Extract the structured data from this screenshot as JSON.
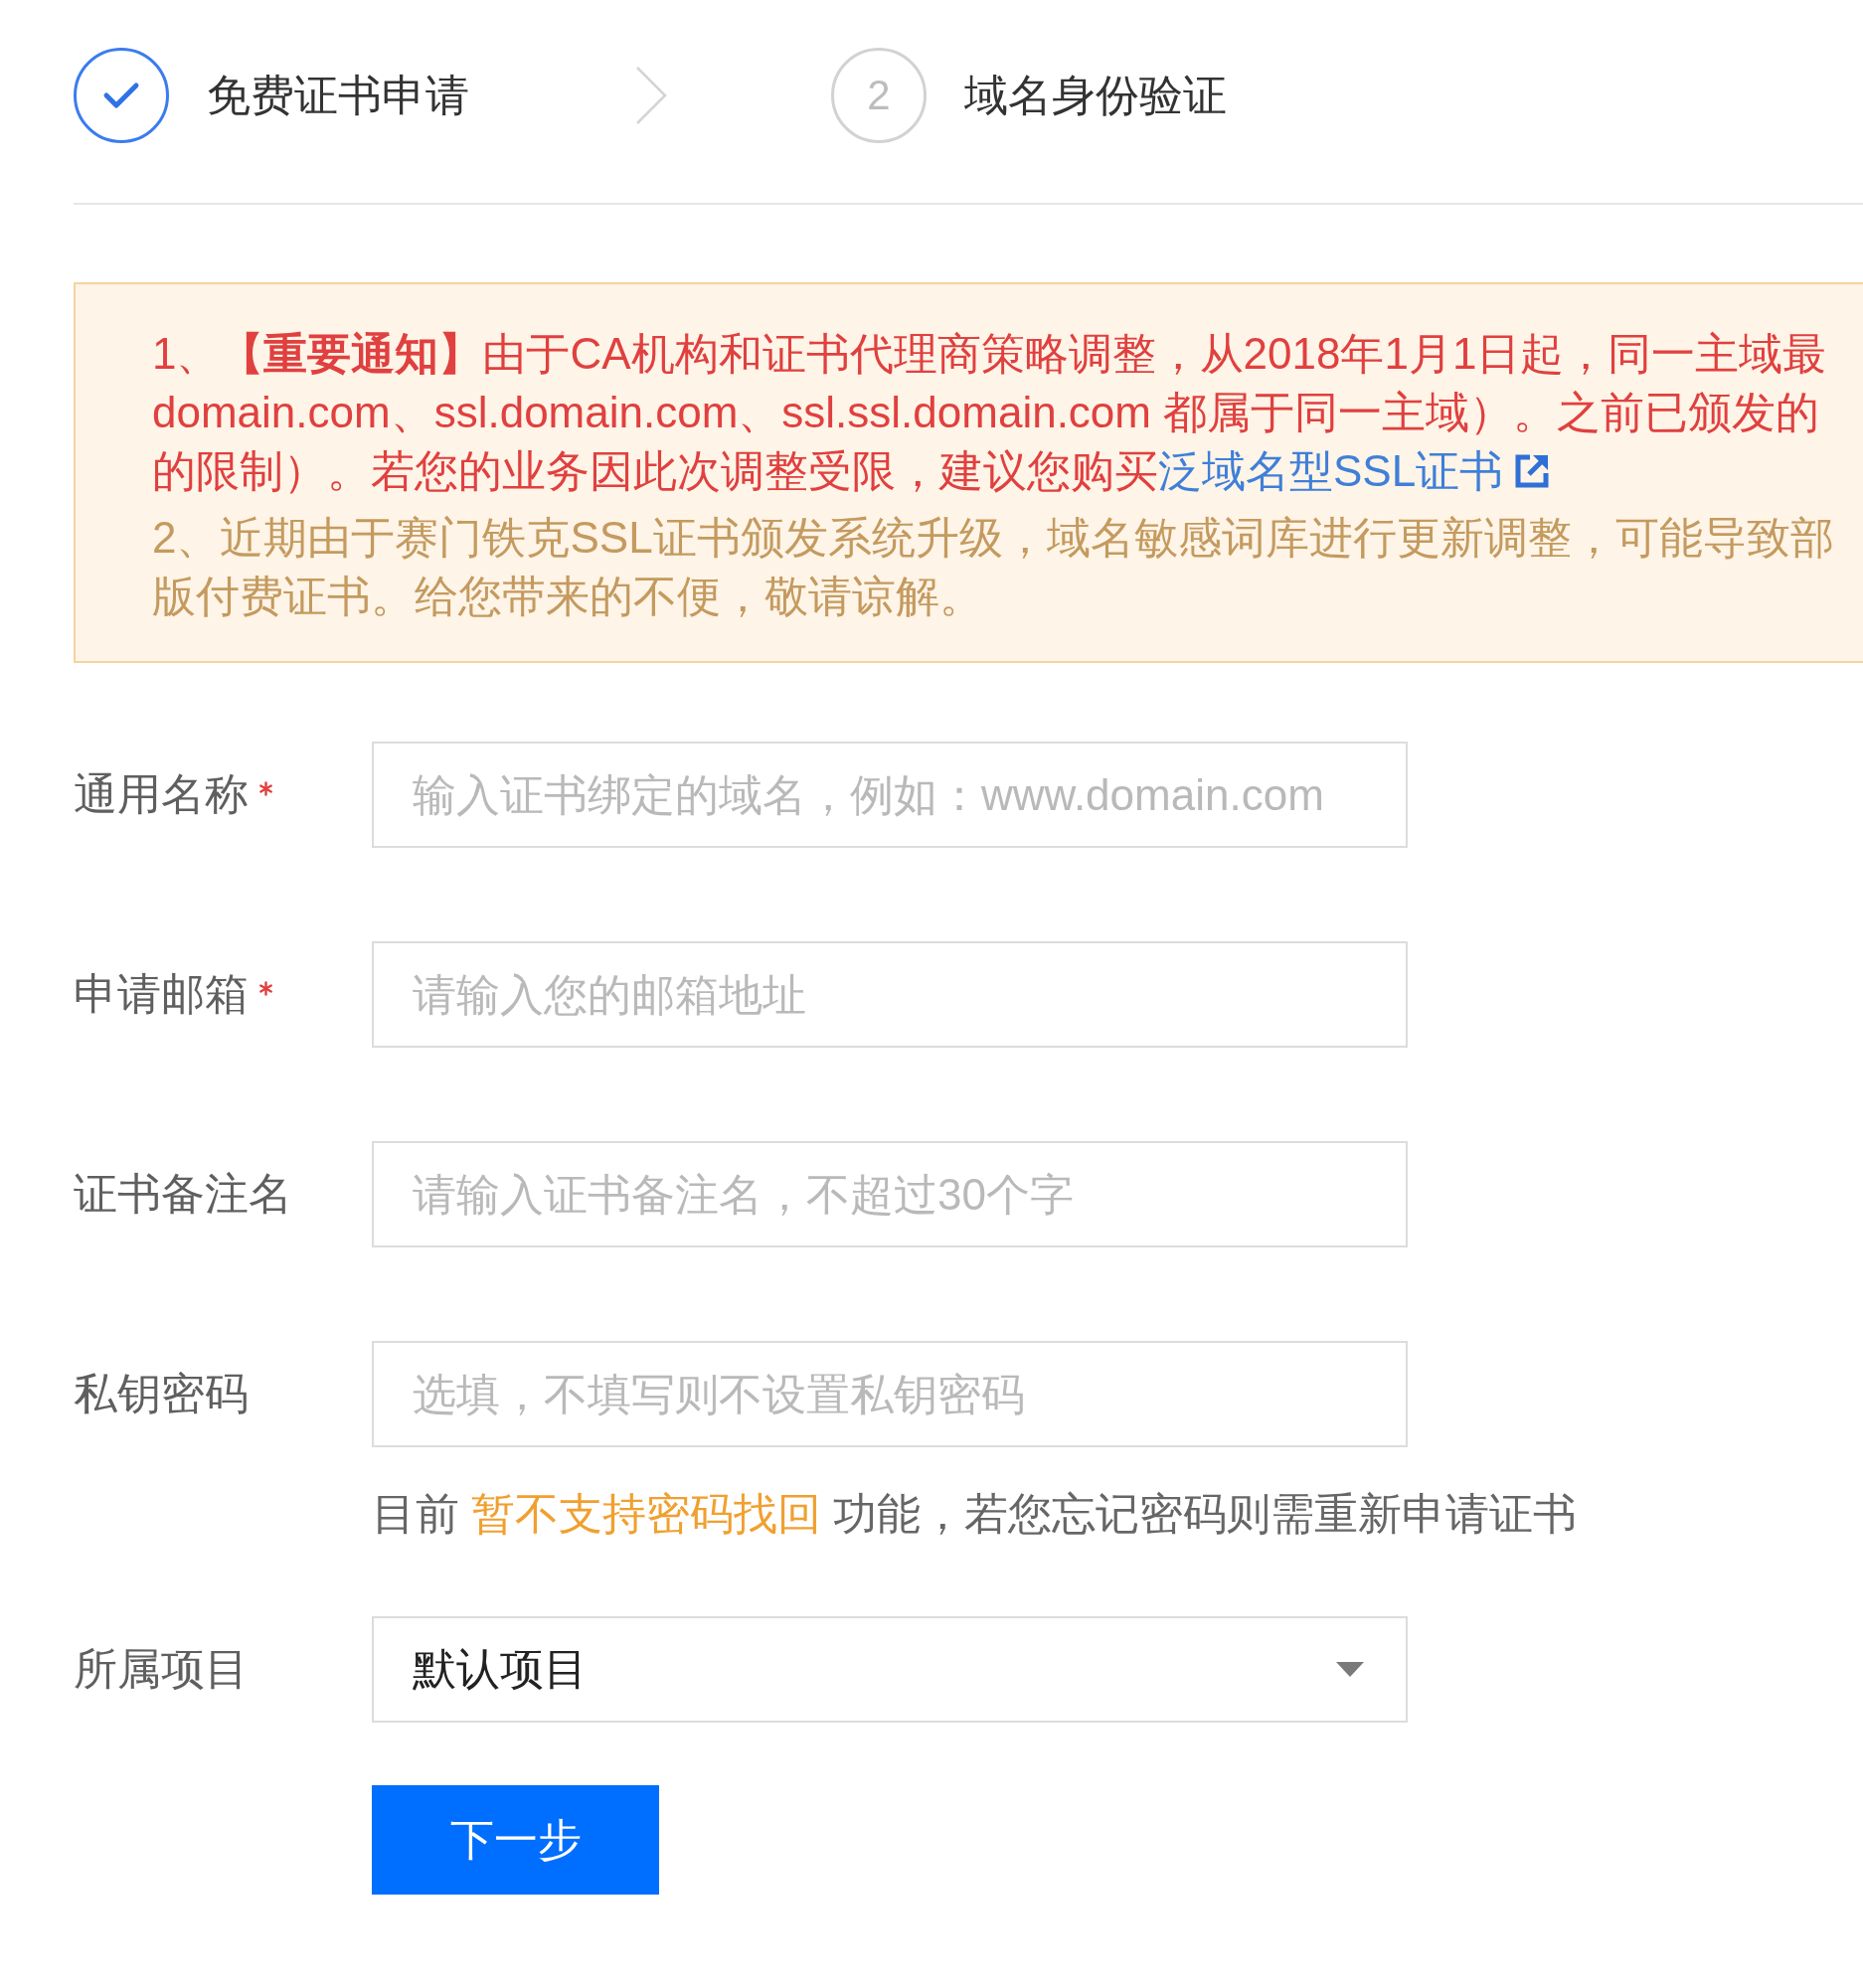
{
  "steps": [
    {
      "label": "免费证书申请",
      "done": true
    },
    {
      "label": "域名身份验证",
      "done": false,
      "number": "2"
    }
  ],
  "notice": {
    "items": [
      {
        "color": "#e0403f",
        "lines": [
          {
            "text": "1、**【重要通知】**由于CA机构和证书代理商策略调整，从2018年1月1日起，同一主域最"
          },
          {
            "text": "domain.com、ssl.domain.com、ssl.ssl.domain.com 都属于同一主域）。之前已颁发的"
          },
          {
            "text": "的限制）。若您的业务因此次调整受限，建议您购买",
            "link": "泛域名型SSL证书"
          }
        ]
      },
      {
        "color": "#c49a5f",
        "lines": [
          {
            "text": "2、近期由于赛门铁克SSL证书颁发系统升级，域名敏感词库进行更新调整，可能导致部"
          },
          {
            "text": "版付费证书。给您带来的不便，敬请谅解。"
          }
        ]
      }
    ]
  },
  "form": {
    "fields": [
      {
        "kind": "text",
        "label": "通用名称",
        "required": true,
        "placeholder": "输入证书绑定的域名，例如：www.domain.com"
      },
      {
        "kind": "text",
        "label": "申请邮箱",
        "required": true,
        "placeholder": "请输入您的邮箱地址"
      },
      {
        "kind": "text",
        "label": "证书备注名",
        "required": false,
        "placeholder": "请输入证书备注名，不超过30个字"
      },
      {
        "kind": "password",
        "label": "私钥密码",
        "required": false,
        "placeholder": "选填，不填写则不设置私钥密码",
        "hint": {
          "before": "目前",
          "highlight": "暂不支持密码找回",
          "after": "功能，若您忘记密码则需重新申请证书"
        }
      },
      {
        "kind": "select",
        "label": "所属项目",
        "required": false,
        "value": "默认项目"
      }
    ],
    "submit": {
      "label": "下一步"
    }
  }
}
